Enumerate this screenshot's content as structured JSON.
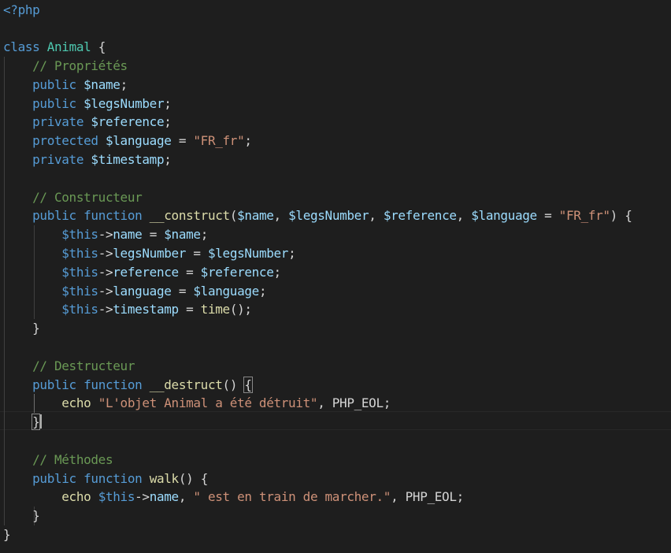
{
  "editor": {
    "language": "php",
    "colors": {
      "background": "#1e1e1e",
      "keyword": "#569cd6",
      "class_name": "#4ec9b0",
      "variable": "#9cdcfe",
      "function": "#dcdcaa",
      "string": "#ce9178",
      "comment": "#6a9955",
      "default": "#d4d4d4"
    },
    "cursor_line": 23,
    "lines": [
      {
        "tokens": [
          {
            "t": "<?php",
            "c": "kw"
          }
        ]
      },
      {
        "tokens": []
      },
      {
        "tokens": [
          {
            "t": "class",
            "c": "kw"
          },
          {
            "t": " ",
            "c": "punc"
          },
          {
            "t": "Animal",
            "c": "cls"
          },
          {
            "t": " {",
            "c": "punc"
          }
        ]
      },
      {
        "tokens": [
          {
            "t": "    ",
            "c": "punc"
          },
          {
            "t": "// Propriétés",
            "c": "cmt"
          }
        ]
      },
      {
        "tokens": [
          {
            "t": "    ",
            "c": "punc"
          },
          {
            "t": "public",
            "c": "kw"
          },
          {
            "t": " ",
            "c": "punc"
          },
          {
            "t": "$name",
            "c": "var"
          },
          {
            "t": ";",
            "c": "punc"
          }
        ]
      },
      {
        "tokens": [
          {
            "t": "    ",
            "c": "punc"
          },
          {
            "t": "public",
            "c": "kw"
          },
          {
            "t": " ",
            "c": "punc"
          },
          {
            "t": "$legsNumber",
            "c": "var"
          },
          {
            "t": ";",
            "c": "punc"
          }
        ]
      },
      {
        "tokens": [
          {
            "t": "    ",
            "c": "punc"
          },
          {
            "t": "private",
            "c": "kw"
          },
          {
            "t": " ",
            "c": "punc"
          },
          {
            "t": "$reference",
            "c": "var"
          },
          {
            "t": ";",
            "c": "punc"
          }
        ]
      },
      {
        "tokens": [
          {
            "t": "    ",
            "c": "punc"
          },
          {
            "t": "protected",
            "c": "kw"
          },
          {
            "t": " ",
            "c": "punc"
          },
          {
            "t": "$language",
            "c": "var"
          },
          {
            "t": " = ",
            "c": "punc"
          },
          {
            "t": "\"FR_fr\"",
            "c": "str"
          },
          {
            "t": ";",
            "c": "punc"
          }
        ]
      },
      {
        "tokens": [
          {
            "t": "    ",
            "c": "punc"
          },
          {
            "t": "private",
            "c": "kw"
          },
          {
            "t": " ",
            "c": "punc"
          },
          {
            "t": "$timestamp",
            "c": "var"
          },
          {
            "t": ";",
            "c": "punc"
          }
        ]
      },
      {
        "tokens": []
      },
      {
        "tokens": [
          {
            "t": "    ",
            "c": "punc"
          },
          {
            "t": "// Constructeur",
            "c": "cmt"
          }
        ]
      },
      {
        "tokens": [
          {
            "t": "    ",
            "c": "punc"
          },
          {
            "t": "public",
            "c": "kw"
          },
          {
            "t": " ",
            "c": "punc"
          },
          {
            "t": "function",
            "c": "kw"
          },
          {
            "t": " ",
            "c": "punc"
          },
          {
            "t": "__construct",
            "c": "fn"
          },
          {
            "t": "(",
            "c": "punc"
          },
          {
            "t": "$name",
            "c": "var"
          },
          {
            "t": ", ",
            "c": "punc"
          },
          {
            "t": "$legsNumber",
            "c": "var"
          },
          {
            "t": ", ",
            "c": "punc"
          },
          {
            "t": "$reference",
            "c": "var"
          },
          {
            "t": ", ",
            "c": "punc"
          },
          {
            "t": "$language",
            "c": "var"
          },
          {
            "t": " = ",
            "c": "punc"
          },
          {
            "t": "\"FR_fr\"",
            "c": "str"
          },
          {
            "t": ") {",
            "c": "punc"
          }
        ]
      },
      {
        "tokens": [
          {
            "t": "        ",
            "c": "punc"
          },
          {
            "t": "$this",
            "c": "kw"
          },
          {
            "t": "->",
            "c": "punc"
          },
          {
            "t": "name",
            "c": "prop"
          },
          {
            "t": " = ",
            "c": "punc"
          },
          {
            "t": "$name",
            "c": "var"
          },
          {
            "t": ";",
            "c": "punc"
          }
        ]
      },
      {
        "tokens": [
          {
            "t": "        ",
            "c": "punc"
          },
          {
            "t": "$this",
            "c": "kw"
          },
          {
            "t": "->",
            "c": "punc"
          },
          {
            "t": "legsNumber",
            "c": "prop"
          },
          {
            "t": " = ",
            "c": "punc"
          },
          {
            "t": "$legsNumber",
            "c": "var"
          },
          {
            "t": ";",
            "c": "punc"
          }
        ]
      },
      {
        "tokens": [
          {
            "t": "        ",
            "c": "punc"
          },
          {
            "t": "$this",
            "c": "kw"
          },
          {
            "t": "->",
            "c": "punc"
          },
          {
            "t": "reference",
            "c": "prop"
          },
          {
            "t": " = ",
            "c": "punc"
          },
          {
            "t": "$reference",
            "c": "var"
          },
          {
            "t": ";",
            "c": "punc"
          }
        ]
      },
      {
        "tokens": [
          {
            "t": "        ",
            "c": "punc"
          },
          {
            "t": "$this",
            "c": "kw"
          },
          {
            "t": "->",
            "c": "punc"
          },
          {
            "t": "language",
            "c": "prop"
          },
          {
            "t": " = ",
            "c": "punc"
          },
          {
            "t": "$language",
            "c": "var"
          },
          {
            "t": ";",
            "c": "punc"
          }
        ]
      },
      {
        "tokens": [
          {
            "t": "        ",
            "c": "punc"
          },
          {
            "t": "$this",
            "c": "kw"
          },
          {
            "t": "->",
            "c": "punc"
          },
          {
            "t": "timestamp",
            "c": "prop"
          },
          {
            "t": " = ",
            "c": "punc"
          },
          {
            "t": "time",
            "c": "fn"
          },
          {
            "t": "();",
            "c": "punc"
          }
        ]
      },
      {
        "tokens": [
          {
            "t": "    }",
            "c": "punc"
          }
        ]
      },
      {
        "tokens": []
      },
      {
        "tokens": [
          {
            "t": "    ",
            "c": "punc"
          },
          {
            "t": "// Destructeur",
            "c": "cmt"
          }
        ]
      },
      {
        "tokens": [
          {
            "t": "    ",
            "c": "punc"
          },
          {
            "t": "public",
            "c": "kw"
          },
          {
            "t": " ",
            "c": "punc"
          },
          {
            "t": "function",
            "c": "kw"
          },
          {
            "t": " ",
            "c": "punc"
          },
          {
            "t": "__destruct",
            "c": "fn"
          },
          {
            "t": "() ",
            "c": "punc"
          },
          {
            "t": "{",
            "c": "punc",
            "match": true
          }
        ]
      },
      {
        "tokens": [
          {
            "t": "        ",
            "c": "punc"
          },
          {
            "t": "echo",
            "c": "echo"
          },
          {
            "t": " ",
            "c": "punc"
          },
          {
            "t": "\"L'objet Animal a été détruit\"",
            "c": "str"
          },
          {
            "t": ", PHP_EOL;",
            "c": "punc"
          }
        ]
      },
      {
        "tokens": [
          {
            "t": "    ",
            "c": "punc"
          },
          {
            "t": "}",
            "c": "punc",
            "match": true
          }
        ]
      },
      {
        "tokens": []
      },
      {
        "tokens": [
          {
            "t": "    ",
            "c": "punc"
          },
          {
            "t": "// Méthodes",
            "c": "cmt"
          }
        ]
      },
      {
        "tokens": [
          {
            "t": "    ",
            "c": "punc"
          },
          {
            "t": "public",
            "c": "kw"
          },
          {
            "t": " ",
            "c": "punc"
          },
          {
            "t": "function",
            "c": "kw"
          },
          {
            "t": " ",
            "c": "punc"
          },
          {
            "t": "walk",
            "c": "fn"
          },
          {
            "t": "() {",
            "c": "punc"
          }
        ]
      },
      {
        "tokens": [
          {
            "t": "        ",
            "c": "punc"
          },
          {
            "t": "echo",
            "c": "echo"
          },
          {
            "t": " ",
            "c": "punc"
          },
          {
            "t": "$this",
            "c": "kw"
          },
          {
            "t": "->",
            "c": "punc"
          },
          {
            "t": "name",
            "c": "prop"
          },
          {
            "t": ", ",
            "c": "punc"
          },
          {
            "t": "\" est en train de marcher.\"",
            "c": "str"
          },
          {
            "t": ", PHP_EOL;",
            "c": "punc"
          }
        ]
      },
      {
        "tokens": [
          {
            "t": "    }",
            "c": "punc"
          }
        ]
      },
      {
        "tokens": [
          {
            "t": "}",
            "c": "punc"
          }
        ]
      }
    ]
  }
}
